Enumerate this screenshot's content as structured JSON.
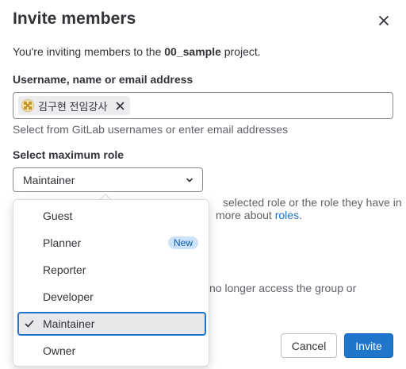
{
  "modal": {
    "title": "Invite members",
    "intro_prefix": "You're inviting members to the ",
    "project_name": "00_sample",
    "intro_suffix": " project."
  },
  "username_field": {
    "label": "Username, name or email address",
    "token_name": "김구현 전임강사",
    "help": "Select from GitLab usernames or enter email addresses"
  },
  "role_field": {
    "label": "Select maximum role",
    "selected_value": "Maintainer",
    "help_line1_visible": "selected role or the role they have in",
    "help_line2_visible": "more about ",
    "help_link": "roles",
    "help_line2_end": ".",
    "help_line3_visible": "no longer access the group or"
  },
  "dropdown": {
    "options": [
      {
        "label": "Guest",
        "badge": "",
        "selected": false
      },
      {
        "label": "Planner",
        "badge": "New",
        "selected": false
      },
      {
        "label": "Reporter",
        "badge": "",
        "selected": false
      },
      {
        "label": "Developer",
        "badge": "",
        "selected": false
      },
      {
        "label": "Maintainer",
        "badge": "",
        "selected": true
      },
      {
        "label": "Owner",
        "badge": "",
        "selected": false
      }
    ]
  },
  "footer": {
    "cancel_label": "Cancel",
    "invite_label": "Invite"
  },
  "colors": {
    "accent": "#1f75cb",
    "badge_bg": "#cbe2f9",
    "selected_bg": "#e8e8eb"
  },
  "icons": {
    "close": "close-icon",
    "chevron": "chevron-down-icon",
    "check": "check-icon",
    "token_remove": "close-icon"
  }
}
